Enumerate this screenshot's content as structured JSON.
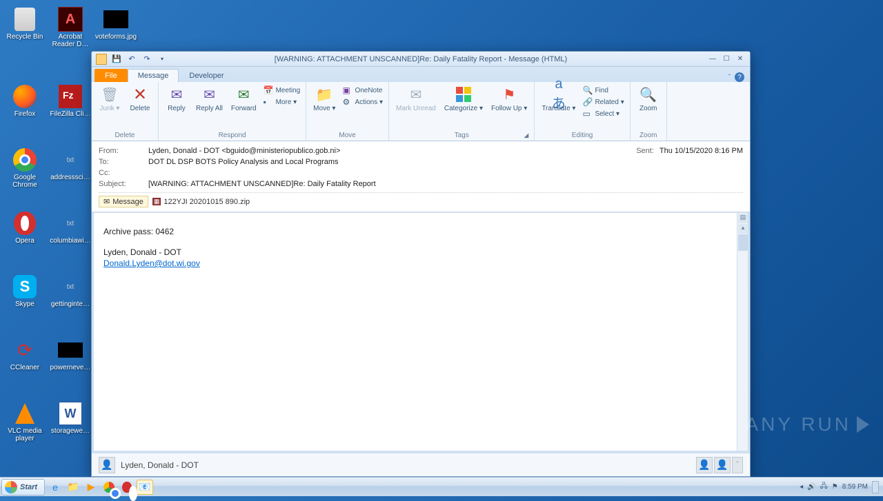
{
  "desktop": {
    "icons_col1": [
      {
        "label": "Recycle Bin"
      },
      {
        "label": "Acrobat Reader D…"
      },
      {
        "label": "voteforms.jpg"
      }
    ],
    "row2": [
      {
        "label": "Firefox"
      },
      {
        "label": "FileZilla Cli…"
      }
    ],
    "row3": [
      {
        "label": "Google Chrome"
      },
      {
        "label": "addresssci…"
      }
    ],
    "row4": [
      {
        "label": "Opera"
      },
      {
        "label": "columbiawi…"
      }
    ],
    "row5": [
      {
        "label": "Skype"
      },
      {
        "label": "gettinginte…"
      }
    ],
    "row6": [
      {
        "label": "CCleaner"
      },
      {
        "label": "powerneve…"
      }
    ],
    "row7": [
      {
        "label": "VLC media player"
      },
      {
        "label": "storagewe…"
      }
    ]
  },
  "window": {
    "title": "[WARNING: ATTACHMENT UNSCANNED]Re: Daily Fatality Report -  Message (HTML)",
    "tabs": {
      "file": "File",
      "message": "Message",
      "developer": "Developer"
    },
    "ribbon": {
      "junk": "Junk",
      "delete": "Delete",
      "group_delete": "Delete",
      "reply": "Reply",
      "replyall": "Reply All",
      "forward": "Forward",
      "meeting": "Meeting",
      "more": "More",
      "group_respond": "Respond",
      "move": "Move",
      "onenote": "OneNote",
      "actions": "Actions",
      "group_move": "Move",
      "markunread": "Mark Unread",
      "categorize": "Categorize",
      "followup": "Follow Up",
      "group_tags": "Tags",
      "translate": "Translate",
      "find": "Find",
      "related": "Related",
      "select": "Select",
      "group_editing": "Editing",
      "zoom": "Zoom",
      "group_zoom": "Zoom"
    },
    "headers": {
      "from_lbl": "From:",
      "from": "Lyden, Donald - DOT <bguido@ministeriopublico.gob.ni>",
      "to_lbl": "To:",
      "to": "DOT DL DSP BOTS Policy Analysis and Local Programs",
      "cc_lbl": "Cc:",
      "cc": "",
      "subj_lbl": "Subject:",
      "subj": "[WARNING: ATTACHMENT UNSCANNED]Re: Daily Fatality Report",
      "sent_lbl": "Sent:",
      "sent": "Thu 10/15/2020 8:16 PM",
      "msg_chip": "Message",
      "attachment": "122YJI 20201015 890.zip"
    },
    "body": {
      "line1": "Archive pass: 0462",
      "sig1": "Lyden, Donald - DOT",
      "sig2": "Donald.Lyden@dot.wi.gov"
    },
    "people": "Lyden, Donald - DOT"
  },
  "taskbar": {
    "start": "Start",
    "clock": "8:59 PM"
  },
  "watermark": "ANY      RUN"
}
